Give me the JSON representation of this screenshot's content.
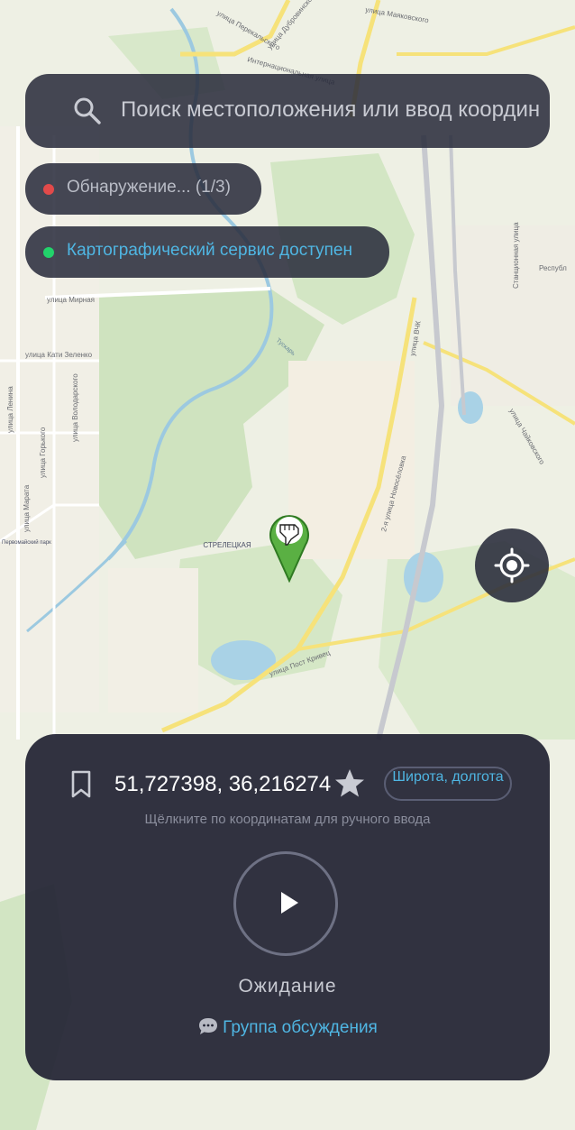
{
  "search": {
    "placeholder": "Поиск местоположения или ввод координ"
  },
  "statuses": [
    {
      "text": "Обнаружение... (1/3)",
      "color": "#e24a4a",
      "text_color": "#b9bcc6"
    },
    {
      "text": "Картографический сервис доступен",
      "color": "#22d36b",
      "text_color": "#4fb6e3"
    }
  ],
  "map": {
    "labels": {
      "district": "СТРЕЛЕЦКАЯ",
      "street_1": "улица Перекальского",
      "street_2": "улица Дубровинского",
      "street_3": "улица Маяковского",
      "street_4": "Интернациональная улица",
      "street_5": "улица Пост Кривец",
      "street_6": "Станционная улица",
      "street_7": "улица Чайковского",
      "street_8": "улица Мирная",
      "street_9": "улица Кати Зеленко",
      "street_10": "2-я улица Новосёловка",
      "street_11": "улица ВЧК",
      "street_12": "Республ",
      "street_13": "Тускарь",
      "street_14": "улица Ленина",
      "street_15": "улица Володарского",
      "street_16": "улица Горького",
      "street_17": "улица Марата",
      "street_18": "Первомайский парк"
    },
    "pin_icon": "pointing-hand-icon"
  },
  "coordinates": {
    "value": "51,727398, 36,216274",
    "format_button": "Широта, долгота",
    "hint": "Щёлкните по координатам для ручного ввода"
  },
  "player": {
    "state": "Ожидание"
  },
  "discussion": {
    "label": "Группа обсуждения"
  },
  "colors": {
    "accent": "#4fb6e3",
    "panel": "#222434",
    "pin": "#5ab043"
  }
}
